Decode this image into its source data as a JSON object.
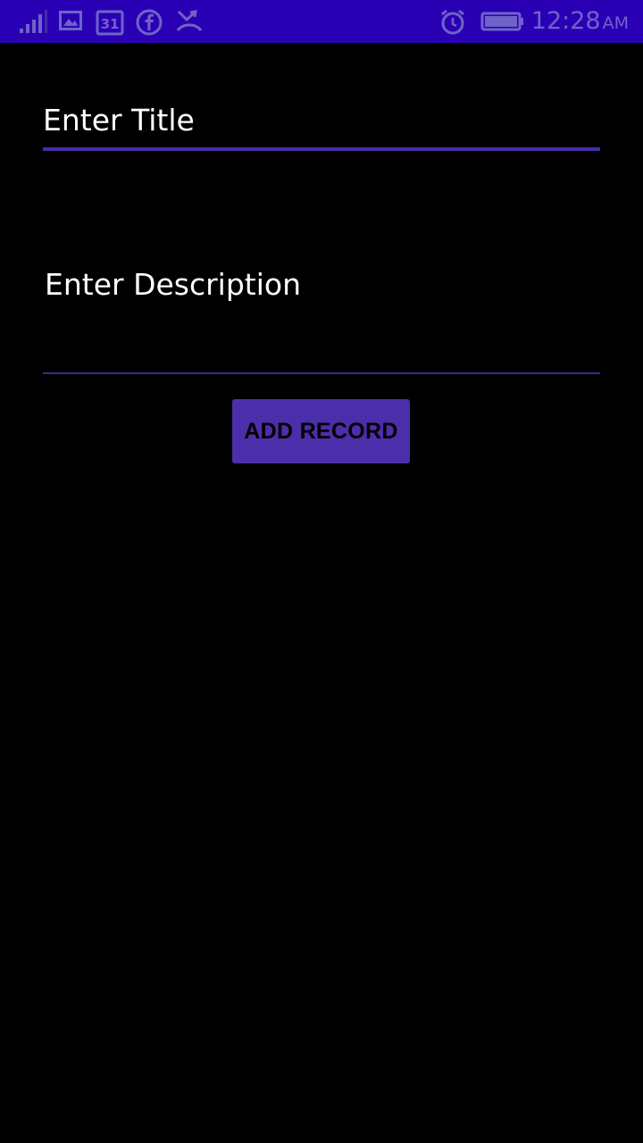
{
  "status_bar": {
    "time": "12:28",
    "ampm": "AM",
    "calendar_day": "31",
    "icons": [
      "signal-icon",
      "gallery-icon",
      "calendar-icon",
      "facebook-icon",
      "missed-call-icon",
      "alarm-icon",
      "battery-icon"
    ],
    "background_color": "#2a00b4",
    "icon_color": "#6f63c9"
  },
  "form": {
    "title_placeholder": "Enter Title",
    "description_placeholder": "Enter Description",
    "add_button_label": "ADD RECORD",
    "accent_color": "#4b2ea9"
  }
}
